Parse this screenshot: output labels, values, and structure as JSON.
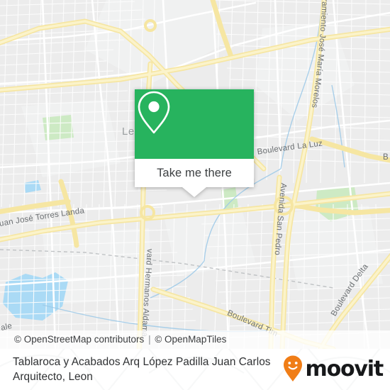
{
  "map": {
    "city_label": "Le",
    "road_labels": [
      {
        "name": "Libramiento José María Morelos",
        "display": "ramiento José María Morelos"
      },
      {
        "name": "Boulevard La Luz",
        "display": "Boulevard La Luz"
      },
      {
        "name": "Avenida San Pedro",
        "display": "Avenida San Pedro"
      },
      {
        "name": "Boulevard Delta",
        "display": "Boulevard Delta"
      },
      {
        "name": "Boulevard Juan José Torres Landa",
        "display": "Juan José Torres Landa"
      },
      {
        "name": "Boulevard Hermanos Aldama",
        "display": "vard Hermanos Aldama"
      },
      {
        "name": "Boulevard Timoteo Lozano",
        "display": "Boulevard Tim"
      },
      {
        "name": "partial-right-edge",
        "display": "B"
      },
      {
        "name": "partial-left-edge",
        "display": "ale"
      }
    ],
    "colors": {
      "land": "#ececec",
      "road_minor": "#ffffff",
      "road_major": "#f8e9a1",
      "park": "#cdeac4",
      "water": "#aadaf5",
      "label_text": "#6b6f72"
    }
  },
  "attribution": {
    "osm": "© OpenStreetMap contributors",
    "separator": "|",
    "tiles": "© OpenMapTiles"
  },
  "popup": {
    "icon": "map-pin-icon",
    "button_label": "Take me there",
    "accent_color": "#27b35e"
  },
  "footer": {
    "title": "Tablaroca y Acabados Arq López Padilla Juan Carlos Arquitecto, Leon",
    "brand": {
      "name": "moovit",
      "icon": "moovit-pin-smiley-icon",
      "pin_color": "#f07d16",
      "word_color": "#17181a"
    }
  }
}
